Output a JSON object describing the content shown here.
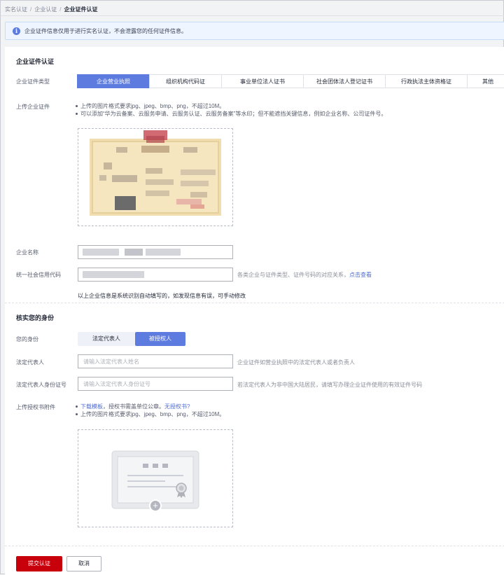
{
  "breadcrumb": {
    "item1": "实名认证",
    "item2": "企业认证",
    "separator": "/",
    "current": "企业证件认证"
  },
  "notice": {
    "icon": "info-icon",
    "text": "企业证件信息仅用于进行实名认证，不会泄露您的任何证件信息。"
  },
  "cert_section": {
    "title": "企业证件认证",
    "type_label": "企业证件类型",
    "tabs": [
      {
        "label": "企业营业执照",
        "active": true
      },
      {
        "label": "组织机构代码证",
        "active": false
      },
      {
        "label": "事业单位法人证书",
        "active": false
      },
      {
        "label": "社会团体法人登记证书",
        "active": false
      },
      {
        "label": "行政执法主体资格证",
        "active": false
      },
      {
        "label": "其他",
        "active": false
      }
    ],
    "upload_label": "上传企业证件",
    "upload_tips": [
      "上传的图片格式要求jpg、jpeg、bmp、png，不超过10M。",
      "可以添加“华为云备案、云服务申请、云服务认证、云服务备案”等水印；但不能遮挡关键信息，例如企业名称、公司证件号。"
    ],
    "company_name_label": "企业名称",
    "credit_code_label": "统一社会信用代码",
    "credit_code_hint": "各类企业与证件类型、证件号码的对应关系，",
    "credit_code_link": "点击查看",
    "auto_fill_note": "以上企业信息是系统识别自动填写的，如发现信息有误，可手动修改"
  },
  "identity_section": {
    "title": "核实您的身份",
    "role_label": "您的身份",
    "roles": [
      {
        "label": "法定代表人",
        "active": false
      },
      {
        "label": "被授权人",
        "active": true
      }
    ],
    "legal_rep_label": "法定代表人",
    "legal_rep_placeholder": "请输入法定代表人姓名",
    "legal_rep_hint": "企业证件如营业执照中的法定代表人或者负责人",
    "legal_rep_id_label": "法定代表人身份证号",
    "legal_rep_id_placeholder": "请输入法定代表人身份证号",
    "legal_rep_id_hint": "若法定代表人为非中国大陆居民，请填写办理企业证件使用的有效证件号码",
    "auth_label": "上传授权书附件",
    "auth_tip1_link": "下载模板",
    "auth_tip1_text": "，授权书需盖单位公章。",
    "auth_tip1_link2": "无授权书?",
    "auth_tip2": "上传的图片格式要求jpg、jpeg、bmp、png，不超过10M。"
  },
  "actions": {
    "submit": "提交认证",
    "cancel": "取消"
  },
  "colors": {
    "primary_blue": "#5e7ce0",
    "submit_red": "#c7000b",
    "link_blue": "#526ecc",
    "license_tan": "#f6e6bf"
  }
}
